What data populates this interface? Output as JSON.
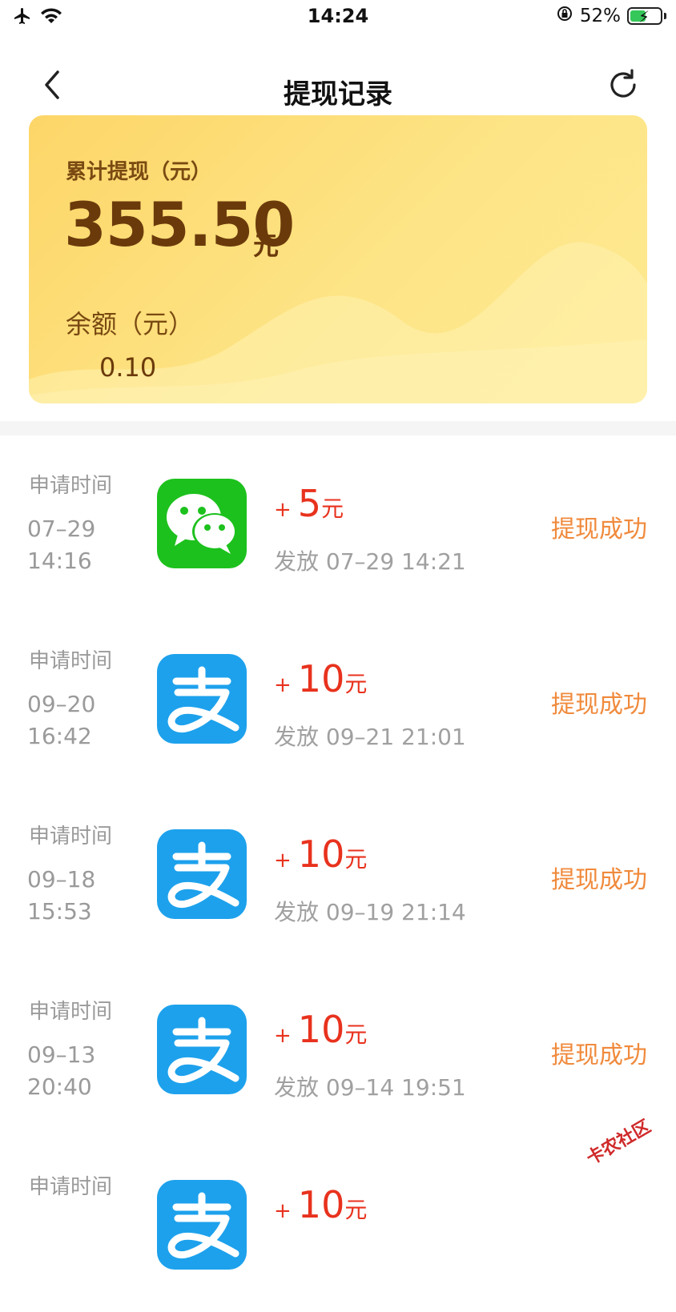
{
  "status_bar": {
    "time": "14:24",
    "battery": "52%"
  },
  "nav": {
    "title": "提现记录"
  },
  "summary": {
    "total_label": "累计提现（元）",
    "total_value": "355.50",
    "total_unit": "元",
    "balance_label": "余额（元）",
    "balance_value": "0.10"
  },
  "records": [
    {
      "req_label": "申请时间",
      "date": "07–29",
      "time": "14:16",
      "method": "wechat",
      "plus": "+",
      "amount": "5",
      "unit": "元",
      "issued": "发放 07–29 14:21",
      "status": "提现成功"
    },
    {
      "req_label": "申请时间",
      "date": "09–20",
      "time": "16:42",
      "method": "alipay",
      "plus": "+",
      "amount": "10",
      "unit": "元",
      "issued": "发放 09–21 21:01",
      "status": "提现成功"
    },
    {
      "req_label": "申请时间",
      "date": "09–18",
      "time": "15:53",
      "method": "alipay",
      "plus": "+",
      "amount": "10",
      "unit": "元",
      "issued": "发放 09–19 21:14",
      "status": "提现成功"
    },
    {
      "req_label": "申请时间",
      "date": "09–13",
      "time": "20:40",
      "method": "alipay",
      "plus": "+",
      "amount": "10",
      "unit": "元",
      "issued": "发放 09–14 19:51",
      "status": "提现成功"
    },
    {
      "req_label": "申请时间",
      "date": "",
      "time": "",
      "method": "alipay",
      "plus": "+",
      "amount": "10",
      "unit": "元",
      "issued": "",
      "status": ""
    }
  ],
  "watermark": "卡农社区",
  "colors": {
    "accent_red": "#e8321e",
    "status_orange": "#f08a3c",
    "card_brown": "#6b3a0b"
  }
}
